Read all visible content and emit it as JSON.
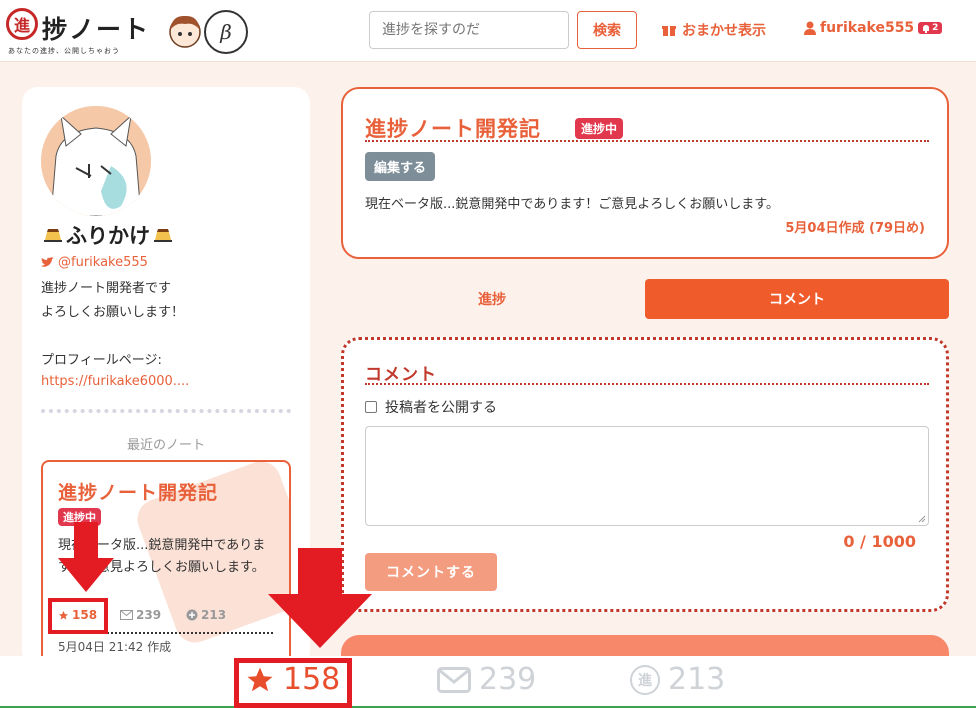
{
  "header": {
    "logo_mark": "進",
    "logo_title": "捗ノート",
    "logo_tagline": "あなたの進捗、公開しちゃおう",
    "beta_mark": "β",
    "search_placeholder": "進捗を探すのだ",
    "search_button": "検索",
    "random_label": "おまかせ表示",
    "username": "furikake555",
    "notification_count": "2"
  },
  "profile": {
    "name": "ふりかけ",
    "twitter": "@furikake555",
    "bio_line1": "進捗ノート開発者です",
    "bio_line2": "よろしくお願いします！",
    "profile_page_label": "プロフィールページ:",
    "profile_link": "https://furikake6000....",
    "recent_notes_label": "最近のノート"
  },
  "recent_note": {
    "title": "進捗ノート開発記",
    "badge": "進捗中",
    "description": "現在ベータ版...鋭意開発中であります！ご意見よろしくお願いします。",
    "stars": "158",
    "comments": "239",
    "progress": "213",
    "date": "5月04日 21:42 作成"
  },
  "note": {
    "title": "進捗ノート開発記",
    "badge": "進捗中",
    "edit_button": "編集する",
    "description": "現在ベータ版...鋭意開発中であります！ご意見よろしくお願いします。",
    "created": "5月04日作成 (79日め)"
  },
  "tabs": {
    "progress": "進捗",
    "comment": "コメント"
  },
  "comment_form": {
    "heading": "コメント",
    "public_label": "投稿者を公開する",
    "char_count": "0 / 1000",
    "submit": "コメントする"
  },
  "bottom_stats": {
    "stars": "158",
    "comments": "239",
    "progress": "213",
    "progress_mark": "進"
  },
  "colors": {
    "accent": "#e8613a",
    "badge_red": "#e2384d",
    "highlight": "#e31b23"
  }
}
